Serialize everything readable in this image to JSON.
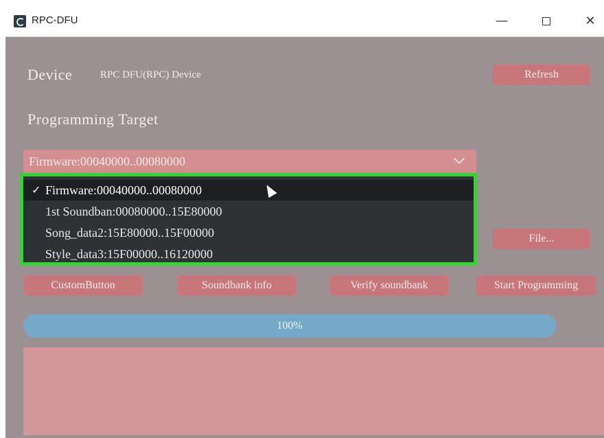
{
  "window": {
    "title": "RPC-DFU",
    "minimize_glyph": "—",
    "close_glyph": "✕"
  },
  "device": {
    "label": "Device",
    "value": "RPC DFU(RPC) Device",
    "refresh_label": "Refresh"
  },
  "target": {
    "label": "Programming Target",
    "selected": "Firmware:00040000..00080000",
    "options": [
      "Firmware:00040000..00080000",
      "1st Soundban:00080000..15E80000",
      "Song_data2:15E80000..15F00000",
      "Style_data3:15F00000..16120000"
    ],
    "check_glyph": "✓"
  },
  "file_button_label": "File...",
  "actions": {
    "custom": "CustomButton",
    "soundbank_info": "Soundbank info",
    "verify": "Verify soundbank",
    "start": "Start Programming"
  },
  "progress": {
    "value": 1.0,
    "text": "100%"
  },
  "colors": {
    "background": "#9b9192",
    "button": "#c7767a",
    "highlight_border": "#30d62f",
    "progress": "#74a9c7"
  }
}
